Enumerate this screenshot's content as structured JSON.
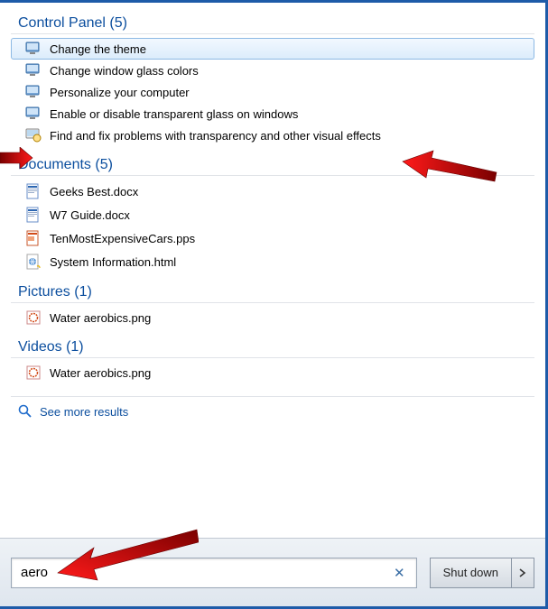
{
  "groups": [
    {
      "header": "Control Panel (5)",
      "items": [
        {
          "icon": "monitor",
          "label": "Change the theme",
          "selected": true
        },
        {
          "icon": "monitor",
          "label": "Change window glass colors"
        },
        {
          "icon": "monitor",
          "label": "Personalize your computer"
        },
        {
          "icon": "monitor",
          "label": "Enable or disable transparent glass on windows"
        },
        {
          "icon": "troubleshoot",
          "label": "Find and fix problems with transparency and other visual effects"
        }
      ]
    },
    {
      "header": "Documents (5)",
      "items": [
        {
          "icon": "docx",
          "label": "Geeks Best.docx"
        },
        {
          "icon": "docx",
          "label": "W7 Guide.docx"
        },
        {
          "icon": "pps",
          "label": "TenMostExpensiveCars.pps"
        },
        {
          "icon": "html",
          "label": "System Information.html"
        }
      ]
    },
    {
      "header": "Pictures (1)",
      "items": [
        {
          "icon": "png",
          "label": "Water aerobics.png"
        }
      ]
    },
    {
      "header": "Videos (1)",
      "items": [
        {
          "icon": "png",
          "label": "Water aerobics.png"
        }
      ]
    }
  ],
  "see_more": "See more results",
  "search": {
    "value": "aero"
  },
  "shutdown": {
    "label": "Shut down"
  }
}
